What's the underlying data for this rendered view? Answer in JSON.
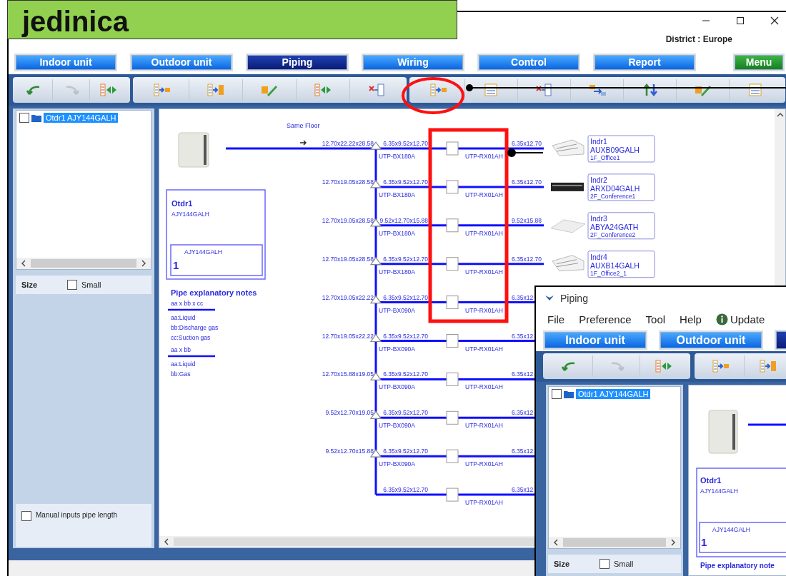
{
  "overlay_label": "jedinica",
  "window": {
    "district": "District : Europe"
  },
  "tabs": [
    {
      "label": "Indoor unit",
      "selected": false,
      "kind": "normal"
    },
    {
      "label": "Outdoor unit",
      "selected": false,
      "kind": "normal"
    },
    {
      "label": "Piping",
      "selected": true,
      "kind": "normal"
    },
    {
      "label": "Wiring",
      "selected": false,
      "kind": "normal"
    },
    {
      "label": "Control",
      "selected": false,
      "kind": "normal"
    },
    {
      "label": "Report",
      "selected": false,
      "kind": "normal"
    },
    {
      "label": "Menu",
      "selected": false,
      "kind": "menu"
    }
  ],
  "toolbar_buttons": [
    {
      "disabled": false
    },
    {
      "disabled": true
    },
    {
      "disabled": false
    },
    {
      "disabled": false
    },
    {
      "disabled": false
    },
    {
      "disabled": false
    },
    {
      "disabled": false
    },
    {
      "disabled": false
    },
    {
      "disabled": false
    },
    {
      "disabled": false
    },
    {
      "disabled": false
    },
    {
      "disabled": false
    },
    {
      "disabled": false
    },
    {
      "disabled": false
    },
    {
      "disabled": false
    }
  ],
  "tree": [
    {
      "label": "Otdr1 AJY144GALH",
      "checked": false,
      "selected": true
    }
  ],
  "size": {
    "label": "Size",
    "option": "Small",
    "checked": false
  },
  "manual_pipe_length": {
    "label": "Manual inputs pipe length",
    "checked": false
  },
  "diagram": {
    "floor_label": "Same Floor",
    "outdoor": {
      "name": "Otdr1",
      "model": "AJY144GALH",
      "unit_model": "AJY144GALH",
      "unit_count": "1"
    },
    "notes": {
      "title": "Pipe explanatory notes",
      "groups": [
        {
          "format": "aa x bb x cc",
          "lines": [
            "aa:Liquid",
            "bb:Discharge gas",
            "cc:Suction gas"
          ]
        },
        {
          "format": "aa x bb",
          "lines": [
            "aa:Liquid",
            "bb:Gas"
          ]
        }
      ]
    },
    "branches": [
      {
        "main_size": "12.70x22.22x28.58",
        "branch_kit": "UTP-BX180A",
        "inlet_size": "6.35x9.52x12.70",
        "joint": "UTP-RX01AH",
        "indoor_size": "6.35x12.70",
        "indoor": {
          "name": "Indr1",
          "model": "AUXB09GALH",
          "room": "1F_Office1",
          "kind": "cassette"
        }
      },
      {
        "main_size": "12.70x19.05x28.58",
        "branch_kit": "UTP-BX180A",
        "inlet_size": "6.35x9.52x12.70",
        "joint": "UTP-RX01AH",
        "indoor_size": "6.35x12.70",
        "indoor": {
          "name": "Indr2",
          "model": "ARXD04GALH",
          "room": "2F_Conference1",
          "kind": "duct"
        }
      },
      {
        "main_size": "12.70x19.05x28.58",
        "branch_kit": "UTP-BX180A",
        "inlet_size": "9.52x12.70x15.88",
        "joint": "UTP-RX01AH",
        "indoor_size": "9.52x15.88",
        "indoor": {
          "name": "Indr3",
          "model": "ABYA24GATH",
          "room": "2F_Conference2",
          "kind": "ceiling"
        }
      },
      {
        "main_size": "12.70x19.05x28.58",
        "branch_kit": "UTP-BX180A",
        "inlet_size": "6.35x9.52x12.70",
        "joint": "UTP-RX01AH",
        "indoor_size": "6.35x12.70",
        "indoor": {
          "name": "Indr4",
          "model": "AUXB14GALH",
          "room": "1F_Office2_1",
          "kind": "cassette"
        }
      },
      {
        "main_size": "12.70x19.05x22.22",
        "branch_kit": "UTP-BX090A",
        "inlet_size": "6.35x9.52x12.70",
        "joint": "UTP-RX01AH",
        "indoor_size": "6.35x12"
      },
      {
        "main_size": "12.70x19.05x22.22",
        "branch_kit": "UTP-BX090A",
        "inlet_size": "6.35x9.52x12.70",
        "joint": "UTP-RX01AH",
        "indoor_size": "6.35x12"
      },
      {
        "main_size": "12.70x15.88x19.05",
        "branch_kit": "UTP-BX090A",
        "inlet_size": "6.35x9.52x12.70",
        "joint": "UTP-RX01AH",
        "indoor_size": "6.35x12"
      },
      {
        "main_size": "9.52x12.70x19.05",
        "branch_kit": "UTP-BX090A",
        "inlet_size": "6.35x9.52x12.70",
        "joint": "UTP-RX01AH",
        "indoor_size": "6.35x12"
      },
      {
        "main_size": "9.52x12.70x15.88",
        "branch_kit": "UTP-BX090A",
        "inlet_size": "6.35x9.52x12.70",
        "joint": "UTP-RX01AH",
        "indoor_size": "6.35x12"
      },
      {
        "inlet_size": "6.35x9.52x12.70",
        "joint": "UTP-RX01AH",
        "indoor_size": "6.35x12"
      }
    ]
  },
  "inset_window": {
    "title": "Piping",
    "menu": [
      {
        "label": "File",
        "kind": "text"
      },
      {
        "label": "Preference",
        "kind": "text"
      },
      {
        "label": "Tool",
        "kind": "text"
      },
      {
        "label": "Help",
        "kind": "text"
      },
      {
        "label": "Update",
        "kind": "info"
      }
    ],
    "tabs": [
      {
        "label": "Indoor unit"
      },
      {
        "label": "Outdoor unit"
      }
    ],
    "toolbar_buttons": [
      {
        "disabled": false
      },
      {
        "disabled": true
      },
      {
        "disabled": false
      },
      {
        "disabled": false
      },
      {
        "disabled": false
      }
    ],
    "tree": [
      {
        "label": "Otdr1 AJY144GALH",
        "checked": false,
        "selected": true
      }
    ],
    "size": {
      "label": "Size",
      "option": "Small",
      "checked": false
    },
    "outdoor": {
      "name": "Otdr1",
      "model": "AJY144GALH",
      "unit_model": "AJY144GALH",
      "unit_count": "1"
    },
    "notes_title": "Pipe explanatory note"
  }
}
